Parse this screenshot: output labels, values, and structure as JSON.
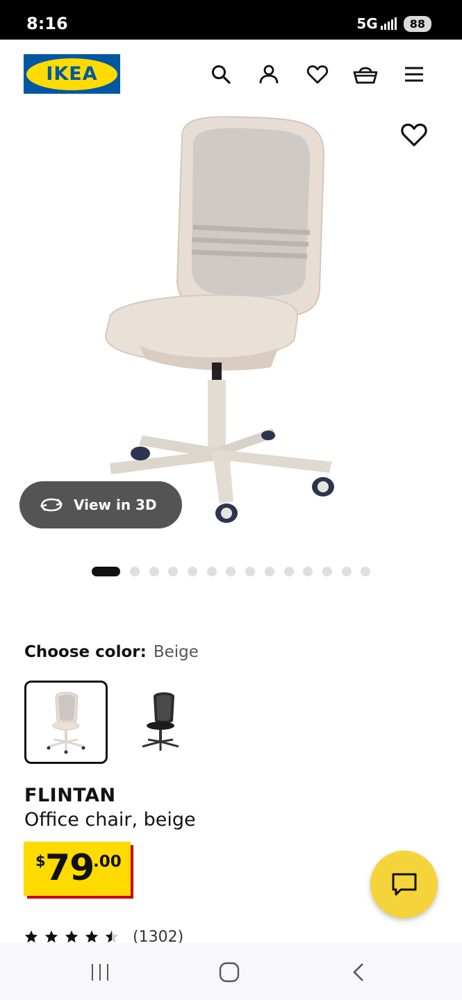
{
  "status_bar": {
    "time": "8:16",
    "network": "5G",
    "battery": "88"
  },
  "header": {
    "logo_text": "IKEA",
    "icons": [
      "search-icon",
      "account-icon",
      "heart-icon",
      "basket-icon",
      "menu-icon"
    ]
  },
  "gallery": {
    "view_3d_label": "View in 3D",
    "image_count": 15,
    "active_index": 0
  },
  "color": {
    "label": "Choose color:",
    "selected": "Beige",
    "options": [
      "beige-chair",
      "black-chair"
    ]
  },
  "product": {
    "name": "FLINTAN",
    "description": "Office chair, beige",
    "price_currency": "$",
    "price_int": "79",
    "price_dec": ".00",
    "rating_value": 4.5,
    "rating_count": "(1302)"
  },
  "colors": {
    "ikea_blue": "#0058a3",
    "ikea_yellow": "#ffdb00",
    "price_red": "#cc0008",
    "chat_yellow": "#f5d33a"
  }
}
